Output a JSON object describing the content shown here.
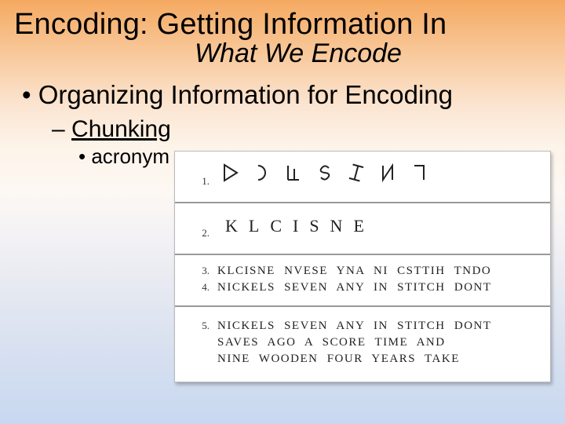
{
  "title": "Encoding: Getting Information In",
  "subtitle": "What We Encode",
  "bullet1": "• Organizing Information for Encoding",
  "dash_prefix": "– ",
  "chunking": "Chunking",
  "bullet2": "• acronym",
  "fig": {
    "n1": "1.",
    "n2": "2.",
    "letters2": "KLCISNE",
    "n3": "3.",
    "l3": "KLCISNE NVESE YNA NI CSTTIH TNDO",
    "n4": "4.",
    "l4": "NICKELS SEVEN ANY IN STITCH DONT",
    "n5": "5.",
    "l5a": "NICKELS SEVEN ANY IN STITCH DONT",
    "l5b": "SAVES AGO A SCORE TIME AND",
    "l5c": "NINE WOODEN FOUR YEARS TAKE"
  }
}
